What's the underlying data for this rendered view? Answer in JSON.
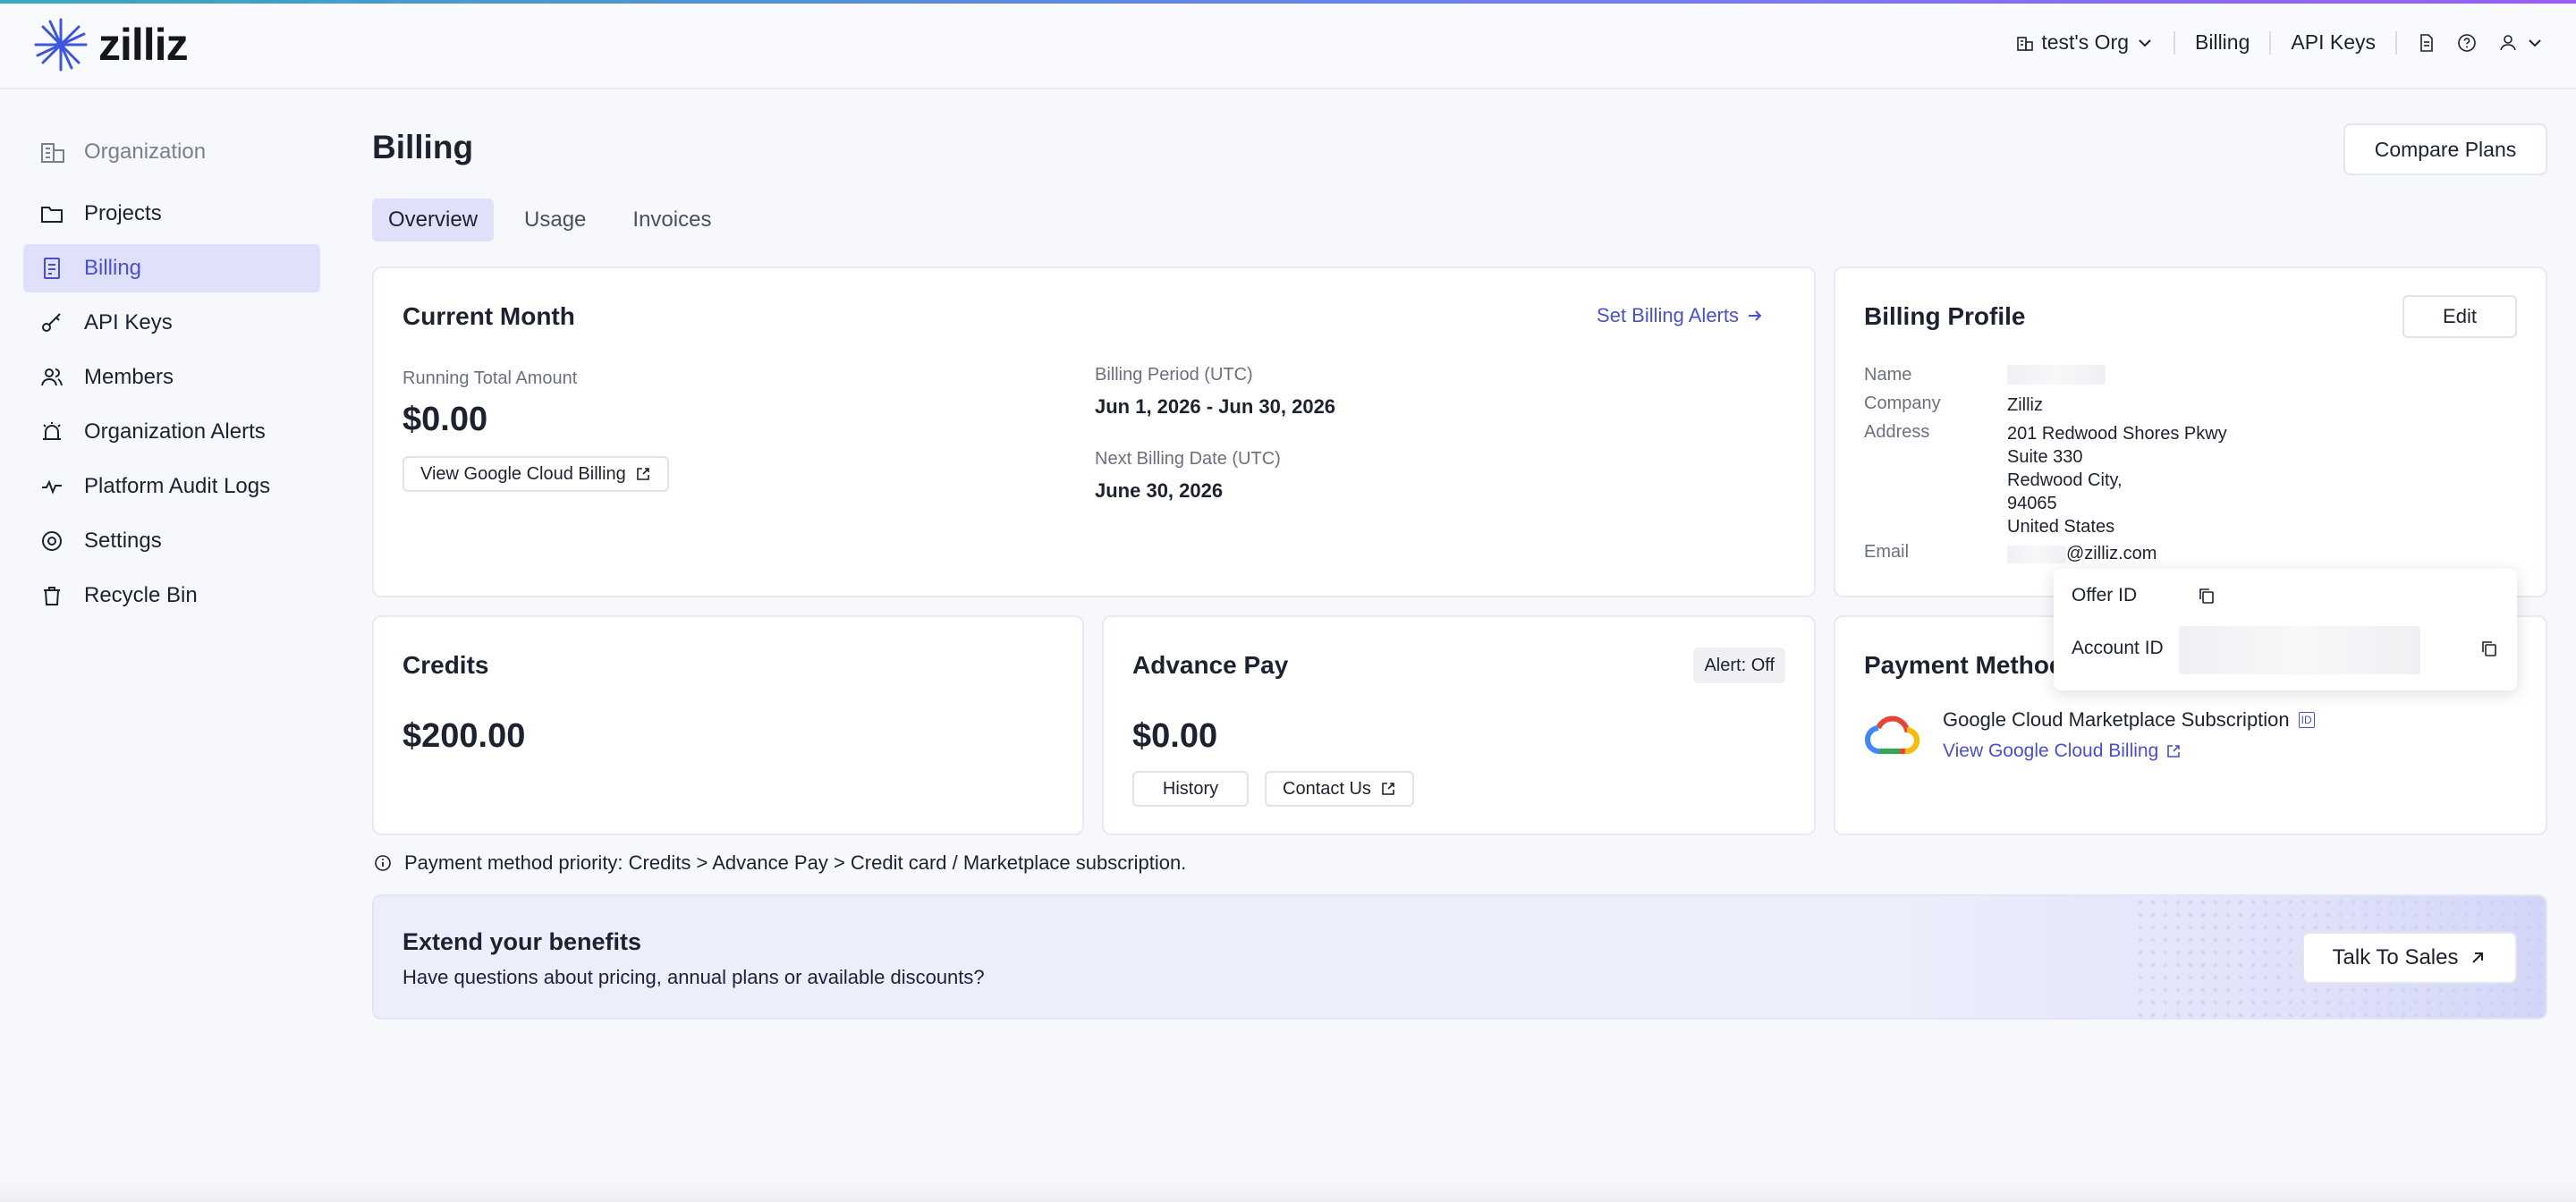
{
  "brand": {
    "name": "zilliz",
    "accent": "#4a4fcf"
  },
  "topnav": {
    "org_label": "test's Org",
    "billing": "Billing",
    "api_keys": "API Keys",
    "icons": [
      "document-icon",
      "help-icon",
      "user-icon"
    ]
  },
  "sidebar": {
    "org_label": "Organization",
    "items": [
      {
        "label": "Projects",
        "icon": "folder-icon",
        "active": false
      },
      {
        "label": "Billing",
        "icon": "billing-icon",
        "active": true
      },
      {
        "label": "API Keys",
        "icon": "key-icon",
        "active": false
      },
      {
        "label": "Members",
        "icon": "members-icon",
        "active": false
      },
      {
        "label": "Organization Alerts",
        "icon": "alarm-icon",
        "active": false
      },
      {
        "label": "Platform Audit Logs",
        "icon": "pulse-icon",
        "active": false
      },
      {
        "label": "Settings",
        "icon": "gear-icon",
        "active": false
      },
      {
        "label": "Recycle Bin",
        "icon": "trash-icon",
        "active": false
      }
    ]
  },
  "page": {
    "title": "Billing",
    "compare_plans": "Compare Plans",
    "tabs": [
      "Overview",
      "Usage",
      "Invoices"
    ],
    "active_tab": "Overview"
  },
  "current_month": {
    "title": "Current Month",
    "set_alerts": "Set Billing Alerts",
    "running_total_label": "Running Total Amount",
    "running_total": "$0.00",
    "view_gcb": "View Google Cloud Billing",
    "billing_period_label": "Billing Period (UTC)",
    "billing_period": "Jun 1, 2026 - Jun 30, 2026",
    "next_billing_label": "Next Billing Date (UTC)",
    "next_billing": "June 30, 2026"
  },
  "billing_profile": {
    "title": "Billing Profile",
    "edit": "Edit",
    "name_label": "Name",
    "company_label": "Company",
    "company": "Zilliz",
    "address_label": "Address",
    "address_lines": [
      "201 Redwood Shores Pkwy",
      "Suite 330",
      "Redwood City,",
      "94065",
      "United States"
    ],
    "email_label": "Email",
    "email_domain": "@zilliz.com"
  },
  "credits": {
    "title": "Credits",
    "amount": "$200.00"
  },
  "advance_pay": {
    "title": "Advance Pay",
    "alert_badge": "Alert: Off",
    "amount": "$0.00",
    "history": "History",
    "contact": "Contact Us"
  },
  "payment_method": {
    "title": "Payment Method",
    "subscription": "Google Cloud Marketplace Subscription",
    "id_badge": "ID",
    "view_gcb": "View Google Cloud Billing"
  },
  "popover": {
    "offer_id_label": "Offer ID",
    "account_id_label": "Account ID"
  },
  "note": "Payment method priority: Credits > Advance Pay > Credit card / Marketplace subscription.",
  "banner": {
    "title": "Extend your benefits",
    "text": "Have questions about pricing, annual plans or available discounts?",
    "cta": "Talk To Sales"
  }
}
